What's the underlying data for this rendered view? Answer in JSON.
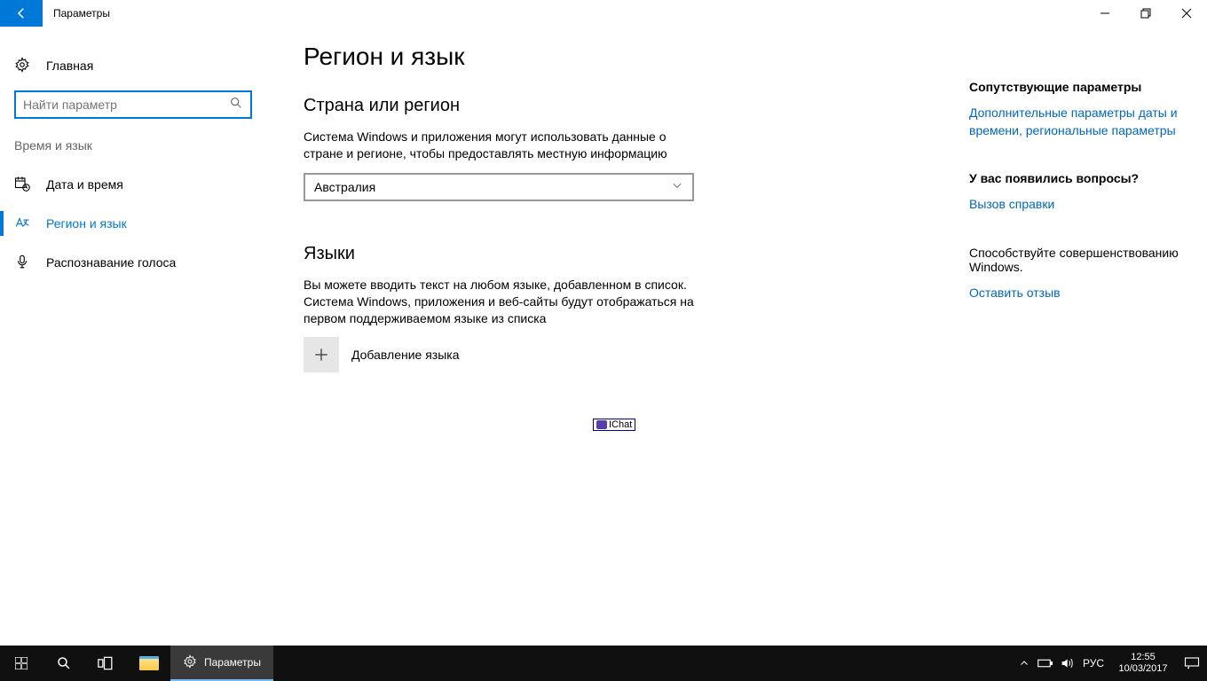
{
  "window": {
    "title": "Параметры"
  },
  "sidebar": {
    "home": "Главная",
    "search_placeholder": "Найти параметр",
    "section": "Время и язык",
    "items": [
      {
        "label": "Дата и время"
      },
      {
        "label": "Регион и язык"
      },
      {
        "label": "Распознавание голоса"
      }
    ]
  },
  "content": {
    "page_title": "Регион и язык",
    "country_heading": "Страна или регион",
    "country_desc": "Система Windows и приложения могут использовать данные о стране и регионе, чтобы предоставлять местную информацию",
    "country_value": "Австралия",
    "languages_heading": "Языки",
    "languages_desc": "Вы можете вводить текст на любом языке, добавленном в список. Система Windows, приложения и веб-сайты будут отображаться на первом поддерживаемом языке из списка",
    "add_language": "Добавление языка",
    "watermark": "IChat"
  },
  "related": {
    "heading": "Сопутствующие параметры",
    "link1": "Дополнительные параметры даты и времени, региональные параметры",
    "questions": "У вас появились вопросы?",
    "help_link": "Вызов справки",
    "improve": "Способствуйте совершенствованию Windows.",
    "feedback_link": "Оставить отзыв"
  },
  "taskbar": {
    "active_app": "Параметры",
    "lang": "РУС",
    "time": "12:55",
    "date": "10/03/2017"
  }
}
